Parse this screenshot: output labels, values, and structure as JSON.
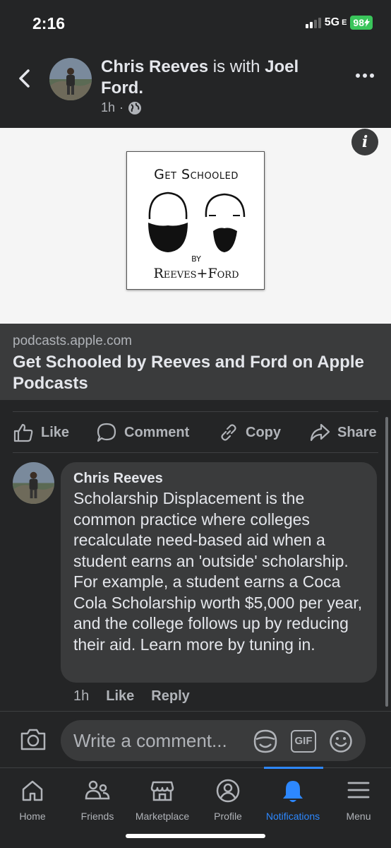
{
  "status_bar": {
    "time": "2:16",
    "network": "5G",
    "network_suffix": "E",
    "battery": "98"
  },
  "post": {
    "author": "Chris Reeves",
    "with_text": "is with",
    "tagged": "Joel Ford.",
    "time": "1h",
    "privacy_icon": "globe-icon"
  },
  "link": {
    "art_title": "Get Schooled",
    "art_by": "by",
    "art_names": "Reeves+Ford",
    "domain": "podcasts.apple.com",
    "title": "Get Schooled by Reeves and Ford on Apple Podcasts"
  },
  "actions": {
    "like": "Like",
    "comment": "Comment",
    "copy": "Copy",
    "share": "Share"
  },
  "comment": {
    "author": "Chris Reeves",
    "text": "Scholarship Displacement is the common practice where colleges recalculate need-based aid when a student earns an 'outside' scholarship.  For example, a student earns a Coca Cola Scholarship worth $5,000 per year, and the college follows up by reducing their aid. Learn more by tuning in.",
    "time": "1h",
    "like": "Like",
    "reply": "Reply"
  },
  "composer": {
    "placeholder": "Write a comment...",
    "gif": "GIF"
  },
  "tabs": [
    {
      "label": "Home",
      "icon": "home-icon"
    },
    {
      "label": "Friends",
      "icon": "friends-icon"
    },
    {
      "label": "Marketplace",
      "icon": "marketplace-icon"
    },
    {
      "label": "Profile",
      "icon": "profile-icon"
    },
    {
      "label": "Notifications",
      "icon": "bell-icon",
      "active": true
    },
    {
      "label": "Menu",
      "icon": "menu-icon"
    }
  ],
  "colors": {
    "background": "#242526",
    "accent": "#2d88ff",
    "battery": "#3ac55b"
  }
}
